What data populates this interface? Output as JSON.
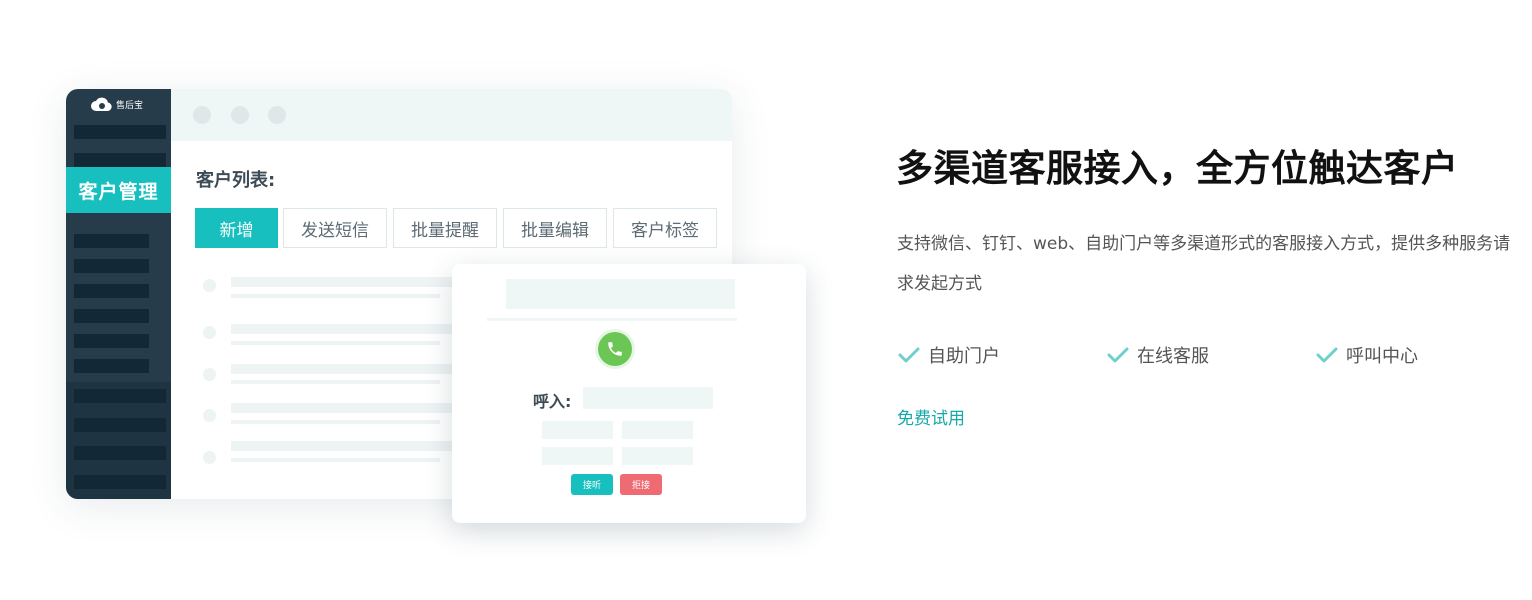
{
  "illustration": {
    "logo_text": "售后宝",
    "sidebar_active": "客户管理",
    "list_title": "客户列表:",
    "tabs": [
      {
        "label": "新增"
      },
      {
        "label": "发送短信"
      },
      {
        "label": "批量提醒"
      },
      {
        "label": "批量编辑"
      },
      {
        "label": "客户标签"
      }
    ],
    "popup": {
      "call_label": "呼入:",
      "accept_label": "接听",
      "reject_label": "拒接"
    }
  },
  "content": {
    "headline": "多渠道客服接入，全方位触达客户",
    "description": "支持微信、钉钉、web、自助门户等多渠道形式的客服接入方式，提供多种服务请求发起方式",
    "features": [
      {
        "label": "自助门户",
        "icon": "check-icon"
      },
      {
        "label": "在线客服",
        "icon": "check-icon"
      },
      {
        "label": "呼叫中心",
        "icon": "check-icon"
      }
    ],
    "cta_label": "免费试用"
  },
  "colors": {
    "accent": "#17c0bf",
    "sidebar": "#263c4b",
    "reject": "#ef6b73",
    "phone": "#6cc655",
    "link": "#17a8a8"
  }
}
